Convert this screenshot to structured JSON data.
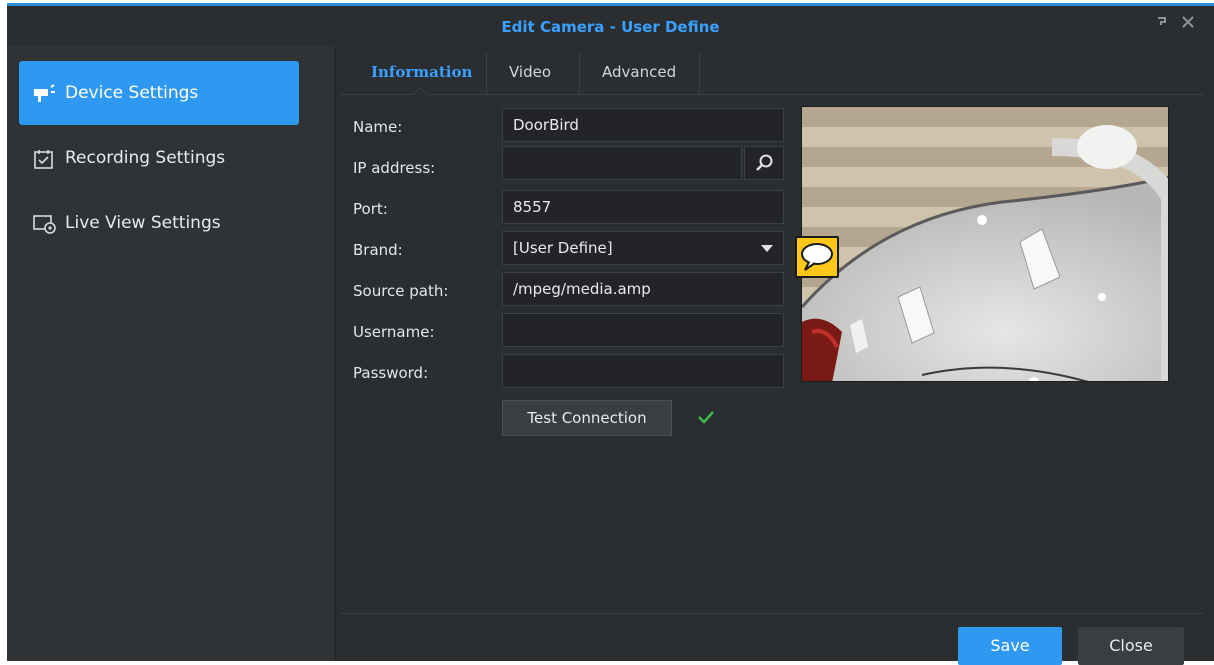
{
  "window": {
    "title": "Edit Camera - User Define",
    "help_icon": "help-icon",
    "close_icon": "close-icon",
    "accent_color": "#2f98f0"
  },
  "sidebar": {
    "items": [
      {
        "label": "Device Settings",
        "icon": "camera-icon",
        "active": true
      },
      {
        "label": "Recording Settings",
        "icon": "calendar-check-icon",
        "active": false
      },
      {
        "label": "Live View Settings",
        "icon": "monitor-eye-icon",
        "active": false
      }
    ]
  },
  "tabs": [
    {
      "label": "Information",
      "active": true
    },
    {
      "label": "Video",
      "active": false
    },
    {
      "label": "Advanced",
      "active": false
    }
  ],
  "form": {
    "name": {
      "label": "Name:",
      "value": "DoorBird"
    },
    "ip": {
      "label": "IP address:",
      "value": ""
    },
    "port": {
      "label": "Port:",
      "value": "8557"
    },
    "brand": {
      "label": "Brand:",
      "value": "[User Define]"
    },
    "source_path": {
      "label": "Source path:",
      "value": "/mpeg/media.amp"
    },
    "username": {
      "label": "Username:",
      "value": ""
    },
    "password": {
      "label": "Password:",
      "value": ""
    }
  },
  "test_connection": {
    "label": "Test Connection",
    "status_icon": "checkmark-icon",
    "status_color": "#3fb54a"
  },
  "preview": {
    "icon": "camera-preview-image"
  },
  "comment": {
    "icon": "speech-bubble-icon",
    "color": "#ffc718"
  },
  "footer": {
    "save_label": "Save",
    "close_label": "Close"
  }
}
